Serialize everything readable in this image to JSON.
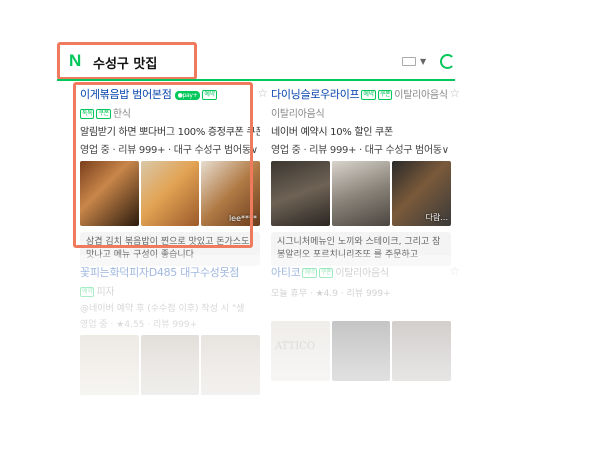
{
  "search": {
    "query": "수성구 맛집",
    "logo_letter": "N"
  },
  "cards": [
    {
      "title": "이게볶음밥 범어본점",
      "pay_badge": "●pay+",
      "book_badge": "예약",
      "badges_line": [
        "톡톡",
        "쿠폰"
      ],
      "category": "한식",
      "promo": "알림받기 하면 뽀다버그 100% 증정쿠폰 쿠폰",
      "meta": "영업 중 · 리뷰 999+ · 대구 수성구 범어동",
      "review": "삼겹 김치 볶음밥이 찐으로 맛있고 돈가스도 맛나고 메뉴 구성이 좋습니다",
      "photo_tag": "lee****"
    },
    {
      "title": "다이닝슬로우라이프",
      "book_badge": "예약",
      "badges_line": [
        "쿠폰"
      ],
      "category": "이탈리아음식",
      "promo": "네이버 예약시 10% 할인 쿠폰",
      "meta": "영업 중 · 리뷰 999+ · 대구 수성구 범어동",
      "review": "시그니처메뉴인 노끼와 스테이크, 그리고 잠봉알리오 포르치니리조또 를 주문하고",
      "photo_tag": "다람..."
    },
    {
      "title": "꽃피는화덕피자D485 대구수성못점",
      "book_badge": "예약",
      "category": "피자",
      "promo": "@네이버 예약 후 (수수점 이후) 작성 시 \"생",
      "meta": "영업 중 · ★4.55 · 리뷰 999+"
    },
    {
      "title": "아티코",
      "book_badge": "예약",
      "badges_line": [
        "쿠폰"
      ],
      "category": "이탈리아음식",
      "meta": "오늘 휴무 · ★4.9 · 리뷰 999+",
      "photo_text": "ATTICO"
    }
  ]
}
